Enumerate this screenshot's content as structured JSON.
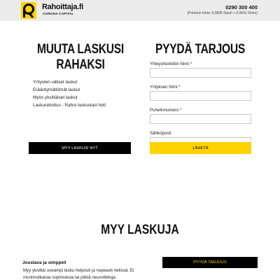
{
  "header": {
    "logo_name": "Rahoittaja.fi",
    "logo_sub": "CORONA CAPITAL",
    "phone": "0290 300 400",
    "price_note": "(Puhelun hinta: 0,0835 €/puh + 0,0641 €/min)",
    "brand_color": "#ffd200"
  },
  "left": {
    "title": "MUUTA LASKUSI RAHAKSI",
    "items": [
      "Yritysten väliset laskut",
      "Erääntymättömät laskut",
      "Myös yksittäiset laskut",
      "Laskurahoitus - Rahoi laskustasi heti"
    ],
    "button_label": "MYY LASKUSI NYT"
  },
  "right": {
    "title": "PYYDÄ TARJOUS",
    "fields": [
      {
        "label": "Yhteyshenkilön Nimi *",
        "value": "",
        "placeholder": ""
      },
      {
        "label": "Yrityksen Nimi *",
        "value": "",
        "placeholder": ""
      },
      {
        "label": "Puhelinnumero *",
        "value": "",
        "placeholder": ""
      },
      {
        "label": "Sähköposti",
        "value": "",
        "placeholder": ""
      }
    ],
    "button_label": "LÄHETÄ"
  },
  "section": {
    "title": "MYY LASKUJA",
    "feature_title": "Joustava ja simppeli",
    "feature_lines": [
      "Myy yksittäi useampi lasku helposti ja nopeasti netissä. Ei",
      "monimutkaisia sopimuksia tai pitkiä neuvotteluja."
    ],
    "quote_button_label": "PYYDÄ TARJOUS"
  }
}
